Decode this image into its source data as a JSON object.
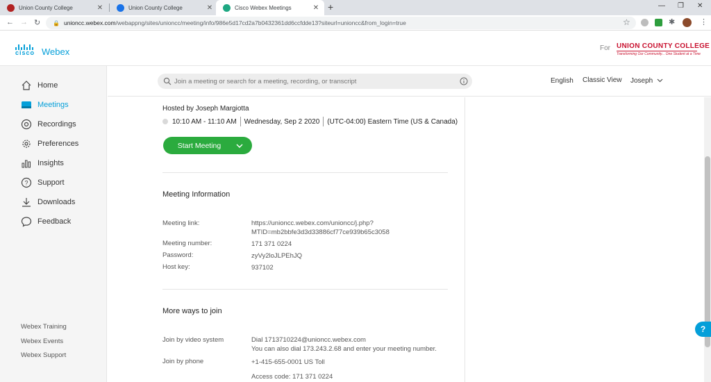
{
  "browser": {
    "tabs": [
      {
        "title": "Union County College",
        "active": false
      },
      {
        "title": "Union County College",
        "active": false
      },
      {
        "title": "Cisco Webex Meetings",
        "active": true
      }
    ],
    "new_tab": "+",
    "window_controls": [
      "—",
      "❐",
      "✕"
    ],
    "url_host": "unioncc.webex.com",
    "url_rest": "/webappng/sites/unioncc/meeting/info/986e5d17cd2a7b0432361dd6ccfdde13?siteurl=unioncc&from_login=true"
  },
  "header": {
    "brand_cisco": "cisco",
    "brand_webex": "Webex",
    "for_label": "For",
    "org_name": "UNION COUNTY COLLEGE",
    "org_tagline": "Transforming Our Community... One Student at a Time"
  },
  "sidebar": {
    "items": [
      {
        "label": "Home",
        "icon": "home-icon",
        "active": false
      },
      {
        "label": "Meetings",
        "icon": "meetings-icon",
        "active": true
      },
      {
        "label": "Recordings",
        "icon": "recordings-icon",
        "active": false
      },
      {
        "label": "Preferences",
        "icon": "gear-icon",
        "active": false
      },
      {
        "label": "Insights",
        "icon": "insights-icon",
        "active": false
      },
      {
        "label": "Support",
        "icon": "help-icon",
        "active": false
      },
      {
        "label": "Downloads",
        "icon": "download-icon",
        "active": false
      },
      {
        "label": "Feedback",
        "icon": "feedback-icon",
        "active": false
      }
    ],
    "footer_links": [
      "Webex Training",
      "Webex Events",
      "Webex Support"
    ]
  },
  "topbar": {
    "search_placeholder": "Join a meeting or search for a meeting, recording, or transcript",
    "language": "English",
    "classic_view": "Classic View",
    "user": "Joseph"
  },
  "meeting": {
    "hosted_by": "Hosted by Joseph Margiotta",
    "time": "10:10 AM - 11:10 AM",
    "date": "Wednesday, Sep 2 2020",
    "timezone": "(UTC-04:00) Eastern Time (US & Canada)",
    "start_button": "Start Meeting"
  },
  "meeting_info": {
    "title": "Meeting Information",
    "link_label": "Meeting link:",
    "link_value_1": "https://unioncc.webex.com/unioncc/j.php?",
    "link_value_2": "MTID=mb2bbfe3d3d33886cf77ce939b65c3058",
    "number_label": "Meeting number:",
    "number_value": "171 371 0224",
    "password_label": "Password:",
    "password_value": "zyVy2loJLPEhJQ",
    "hostkey_label": "Host key:",
    "hostkey_value": "937102"
  },
  "join": {
    "title": "More ways to join",
    "video_label": "Join by video system",
    "video_value_1": "Dial 1713710224@unioncc.webex.com",
    "video_value_2": "You can also dial 173.243.2.68 and enter your meeting number.",
    "phone_label": "Join by phone",
    "phone_value": "+1-415-655-0001 US Toll",
    "access_code": "Access code: 171 371 0224"
  },
  "help_bubble": "?",
  "colors": {
    "accent": "#049fd9",
    "start_green": "#2bab3e",
    "org_red": "#c8102e"
  }
}
